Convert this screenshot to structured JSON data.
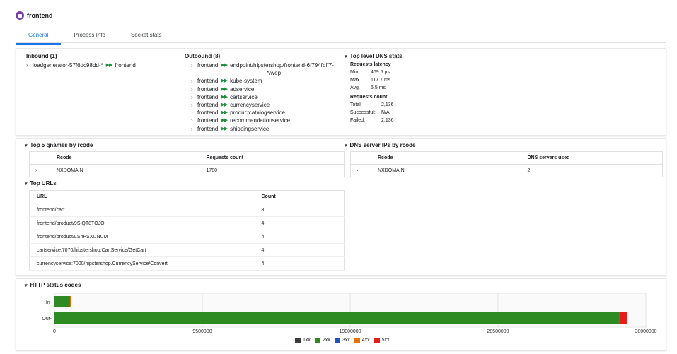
{
  "header": {
    "title": "frontend"
  },
  "tabs": [
    {
      "label": "General",
      "active": true
    },
    {
      "label": "Process Info",
      "active": false
    },
    {
      "label": "Socket stats",
      "active": false
    }
  ],
  "inbound": {
    "heading": "Inbound (1)",
    "items": [
      {
        "source": "loadgenerator-57f6dc98dd-*",
        "target": "frontend"
      }
    ]
  },
  "outbound": {
    "heading": "Outbound (8)",
    "source": "frontend",
    "targets": [
      "endpoint/hipstershop/frontend-6f794fbff7-",
      "kube-system",
      "adservice",
      "cartservice",
      "currencyservice",
      "productcatalogservice",
      "recommendationservice",
      "shippingservice"
    ],
    "first_target_cont": "*/wep"
  },
  "dns_stats": {
    "heading": "Top level DNS stats",
    "latency_heading": "Requests latency",
    "latency": [
      {
        "k": "Min.",
        "v": "469.5 µs"
      },
      {
        "k": "Max.",
        "v": "117.7 ms"
      },
      {
        "k": "Avg.",
        "v": "5.5 ms"
      }
    ],
    "count_heading": "Requests count",
    "counts": [
      {
        "k": "Total:",
        "v": "2,136"
      },
      {
        "k": "Successful:",
        "v": "N/A"
      },
      {
        "k": "Failed:",
        "v": "2,136"
      }
    ]
  },
  "qnames": {
    "heading": "Top 5 qnames by rcode",
    "columns": [
      "Rcode",
      "Requests count"
    ],
    "rows": [
      {
        "rcode": "NXDOMAIN",
        "count": "1780"
      }
    ]
  },
  "dns_servers": {
    "heading": "DNS server IPs by rcode",
    "columns": [
      "Rcode",
      "DNS servers used"
    ],
    "rows": [
      {
        "rcode": "NXDOMAIN",
        "count": "2"
      }
    ]
  },
  "urls": {
    "heading": "Top URLs",
    "columns": [
      "URL",
      "Count"
    ],
    "rows": [
      {
        "url": "frontend/cart",
        "count": "8"
      },
      {
        "url": "frontend/product/9SIQT8TOJO",
        "count": "4"
      },
      {
        "url": "frontend/product/LS4PSXUNUM",
        "count": "4"
      },
      {
        "url": "cartservice:7070/hipstershop.CartService/GetCart",
        "count": "4"
      },
      {
        "url": "currencyservice:7000/hipstershop.CurrencyService/Convert",
        "count": "4"
      }
    ]
  },
  "http": {
    "heading": "HTTP status codes",
    "chart_data": {
      "type": "bar",
      "orientation": "horizontal",
      "stacked": true,
      "categories": [
        "In",
        "Out"
      ],
      "xlim": [
        0,
        38000000
      ],
      "xticks": [
        "0",
        "9500000",
        "19000000",
        "28500000",
        "38000000"
      ],
      "xtick_values": [
        0,
        9500000,
        19000000,
        28500000,
        38000000
      ],
      "series": [
        {
          "name": "1xx",
          "color": "#3c3c3c",
          "values": [
            0,
            0
          ]
        },
        {
          "name": "2xx",
          "color": "#2e8b23",
          "values": [
            1000000,
            36300000
          ]
        },
        {
          "name": "3xx",
          "color": "#1a56b8",
          "values": [
            0,
            0
          ]
        },
        {
          "name": "4xx",
          "color": "#e8710a",
          "values": [
            60000,
            0
          ]
        },
        {
          "name": "5xx",
          "color": "#e61c1c",
          "values": [
            0,
            500000
          ]
        }
      ],
      "legend": "bottom-center",
      "grid": true
    }
  }
}
